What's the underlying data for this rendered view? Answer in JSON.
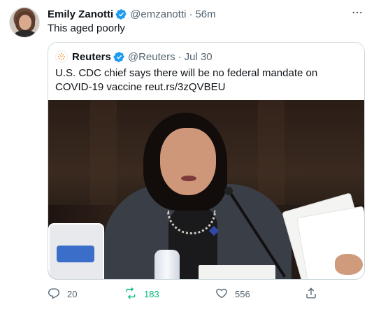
{
  "tweet": {
    "author_name": "Emily Zanotti",
    "handle": "@emzanotti",
    "separator": "·",
    "time": "56m",
    "text": "This aged poorly",
    "more_label": "···"
  },
  "quote": {
    "author_name": "Reuters",
    "handle": "@Reuters",
    "separator": "·",
    "time": "Jul 30",
    "text": "U.S. CDC chief says there will be no federal mandate on COVID-19 vaccine reut.rs/3zQVBEU"
  },
  "actions": {
    "reply_count": "20",
    "retweet_count": "183",
    "like_count": "556"
  },
  "icons": {
    "verified": "verified-badge-icon",
    "reply": "reply-icon",
    "retweet": "retweet-icon",
    "like": "heart-icon",
    "share": "share-icon",
    "more": "more-icon"
  },
  "colors": {
    "verified": "#1d9bf0",
    "muted": "#536471",
    "retweet_active": "#00ba7c",
    "border": "#cfd9de"
  }
}
